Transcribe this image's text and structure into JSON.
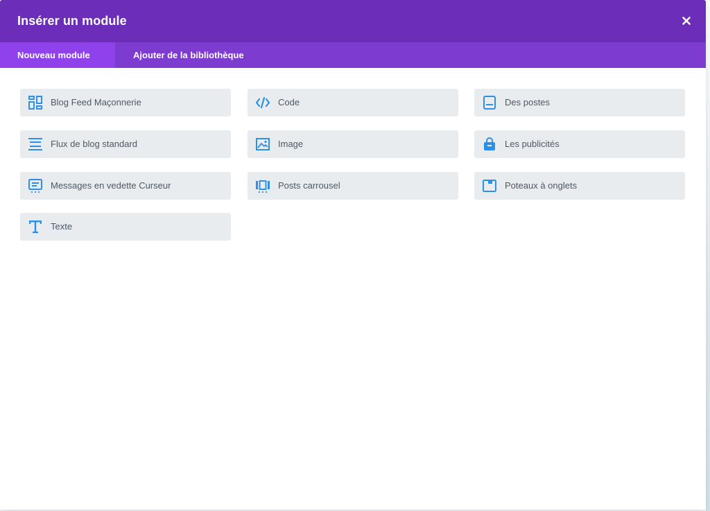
{
  "dialog": {
    "title": "Insérer un module",
    "close_symbol": "×"
  },
  "tabs": [
    {
      "label": "Nouveau module",
      "active": true
    },
    {
      "label": "Ajouter de la bibliothèque",
      "active": false
    }
  ],
  "colors": {
    "header": "#6c2eb9",
    "tab_bar": "#7e3bd0",
    "tab_active": "#8f42ec",
    "icon": "#2e8fe6",
    "module_bg": "#e9ecef",
    "module_text": "#4c5866"
  },
  "modules": [
    {
      "label": "Blog Feed Maçonnerie",
      "icon": "masonry-grid-icon"
    },
    {
      "label": "Code",
      "icon": "code-icon"
    },
    {
      "label": "Des postes",
      "icon": "posts-icon"
    },
    {
      "label": "Flux de blog standard",
      "icon": "blog-standard-icon"
    },
    {
      "label": "Image",
      "icon": "image-icon"
    },
    {
      "label": "Les publicités",
      "icon": "shopping-bag-icon"
    },
    {
      "label": "Messages en vedette Curseur",
      "icon": "featured-slider-icon"
    },
    {
      "label": "Posts carrousel",
      "icon": "carousel-icon"
    },
    {
      "label": "Poteaux à onglets",
      "icon": "tabbed-posts-icon"
    },
    {
      "label": "Texte",
      "icon": "text-icon"
    }
  ]
}
